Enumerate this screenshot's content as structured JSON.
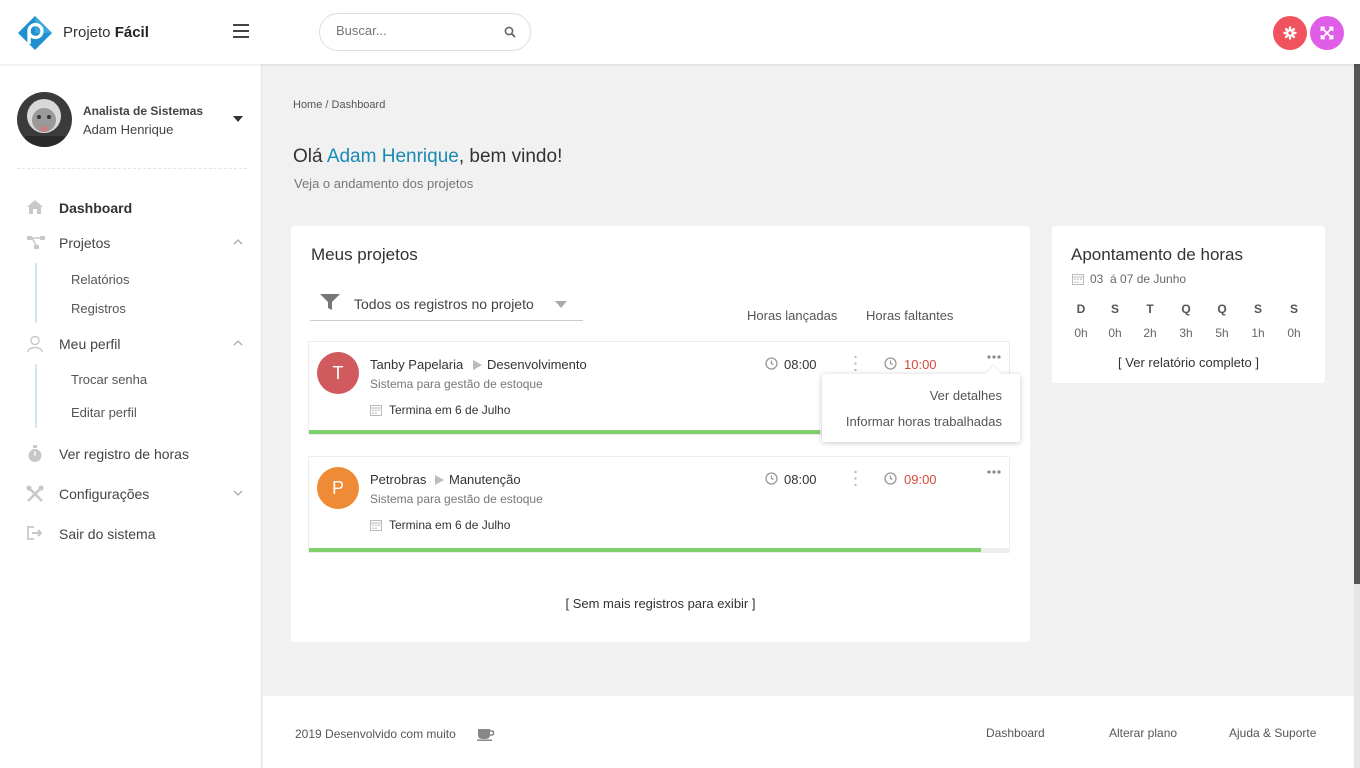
{
  "header": {
    "brand_regular": "Projeto ",
    "brand_bold": "Fácil",
    "search_placeholder": "Buscar...",
    "settings_color": "#f0535d",
    "fullscreen_color": "#e05de8"
  },
  "user": {
    "role": "Analista de Sistemas",
    "name": "Adam Henrique"
  },
  "sidebar": {
    "items": [
      {
        "label": "Dashboard",
        "icon": "home-icon"
      },
      {
        "label": "Projetos",
        "icon": "sitemap-icon"
      },
      {
        "label": "Meu perfil",
        "icon": "user-icon"
      },
      {
        "label": "Ver registro de horas",
        "icon": "stopwatch-icon"
      },
      {
        "label": "Configurações",
        "icon": "tools-icon"
      },
      {
        "label": "Sair do sistema",
        "icon": "logout-icon"
      }
    ],
    "projetos_sub": [
      "Relatórios",
      "Registros"
    ],
    "perfil_sub": [
      "Trocar senha",
      "Editar perfil"
    ]
  },
  "main": {
    "breadcrumb": "Home / Dashboard",
    "greeting_prefix": "Olá ",
    "greeting_name": "Adam Henrique",
    "greeting_suffix": ", bem vindo!",
    "subtitle": "Veja o andamento dos projetos"
  },
  "projects_card": {
    "title": "Meus projetos",
    "filter": "Todos os registros no projeto",
    "col_launched": "Horas lançadas",
    "col_remaining": "Horas faltantes",
    "no_more": "[ Sem mais registros para exibir ]",
    "projects": [
      {
        "initial": "T",
        "avatar_color": "#d05a5e",
        "client": "Tanby Papelaria",
        "phase": "Desenvolvimento",
        "description": "Sistema para gestão de estoque",
        "end": "Termina em 6 de Julho",
        "hours_launched": "08:00",
        "hours_remaining": "10:00",
        "progress": 0.73
      },
      {
        "initial": "P",
        "avatar_color": "#ef8a36",
        "client": "Petrobras",
        "phase": "Manutenção",
        "description": "Sistema para gestão de estoque",
        "end": "Termina em 6 de Julho",
        "hours_launched": "08:00",
        "hours_remaining": "09:00",
        "progress": 0.96
      }
    ],
    "menu": [
      "Ver detalhes",
      "Informar horas trabalhadas"
    ]
  },
  "hours_card": {
    "title": "Apontamento de horas",
    "range": "03  á 07 de Junho",
    "days": [
      {
        "d": "D",
        "h": "0h"
      },
      {
        "d": "S",
        "h": "0h"
      },
      {
        "d": "T",
        "h": "2h"
      },
      {
        "d": "Q",
        "h": "3h"
      },
      {
        "d": "Q",
        "h": "5h"
      },
      {
        "d": "S",
        "h": "1h"
      },
      {
        "d": "S",
        "h": "0h"
      }
    ],
    "report_link": "[ Ver relatório completo ]"
  },
  "footer": {
    "text": "2019 Desenvolvido com muito",
    "links": [
      "Dashboard",
      "Alterar plano",
      "Ajuda & Suporte"
    ]
  }
}
